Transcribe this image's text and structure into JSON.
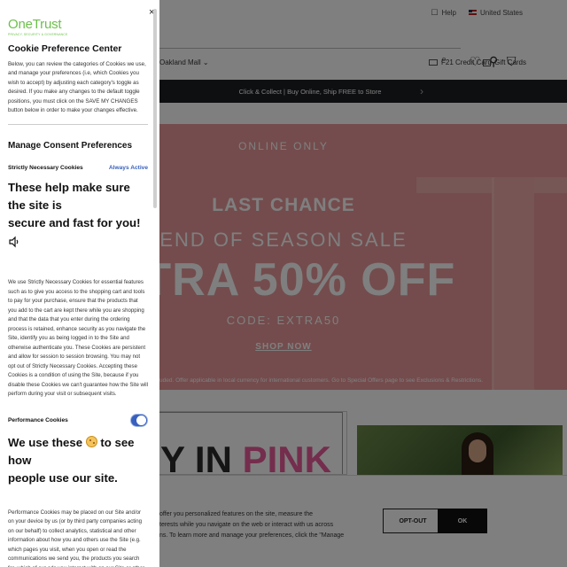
{
  "site": {
    "top": {
      "help": "Help",
      "country": "United States"
    },
    "store": {
      "name": "Oakland Mall",
      "credit_card": "F21 Credit Card",
      "gift_cards": "Gift Cards"
    },
    "promo": {
      "text": "Click & Collect | Buy Online, Ship FREE to Store"
    },
    "hero": {
      "online_only": "ONLINE ONLY",
      "last_chance": "LAST CHANCE",
      "end_of_season": "END OF SEASON SALE",
      "extra": "XTRA 50% OFF",
      "code": "CODE: EXTRA50",
      "shop_now": "SHOP NOW",
      "disclaimer": "uded. Offer applicable in local currency for international customers. Go to Special Offers page to see Exclusions & Restrictions."
    },
    "pink_section": {
      "word1": "Y IN ",
      "word2": "PINK"
    },
    "banner": {
      "text": "offer you personalized features on the site, measure the\nterests while you navigate on the web or interact with us across\nns. To learn more and manage your preferences, click the \"Manage",
      "opt_out": "OPT-OUT",
      "ok": "OK"
    }
  },
  "preference_center": {
    "logo": "OneTrust",
    "logo_tagline": "PRIVACY, SECURITY & GOVERNANCE",
    "close": "×",
    "title": "Cookie Preference Center",
    "description": "Below, you can review the categories of Cookies we use, and manage your preferences (i.e, which Cookies you wish to accept) by adjusting each category's toggle as desired. If you make any changes to the default toggle positions, you must click on the SAVE MY CHANGES button below in order to make your changes effective.",
    "manage_heading": "Manage Consent Preferences",
    "strict": {
      "name": "Strictly Necessary Cookies",
      "status": "Always Active",
      "headline_1": "These help make sure the site is",
      "headline_2": "secure and fast for you!",
      "description": "We use Strictly Necessary Cookies for essential features such as to give you access to the shopping cart and tools to pay for your purchase, ensure that the products that you add to the cart are kept there while you are shopping and that the data that you enter during the ordering process is retained, enhance security as you navigate the Site, identify you as being logged in to the Site and otherwise authenticate you. These Cookies are persistent and allow for session to session browsing. You may not opt out of Strictly Necessary Cookies. Accepting these Cookies is a condition of using the Site, because if you disable these Cookies we can't guarantee how the Site will perform during your visit or subsequent visits."
    },
    "performance": {
      "name": "Performance Cookies",
      "toggle_on": true,
      "headline_1a": "We use these",
      "headline_1b": "to see how",
      "headline_2": "people use our site.",
      "description": "Performance Cookies may be placed on our Site and/or on your device by us (or by third party companies acting on our behalf) to collect analytics, statistical and other information about how you and others use the Site (e.g. which pages you visit, when you open or read the communications we send you, the products you search for, which of our ads you interact with on our Site or other sites where our ads may appear, if you receive any error messages, how many users have viewed a product,"
    }
  },
  "colors": {
    "accent": "#3860be",
    "logo_green": "#6cc04a",
    "hero_pink": "#e8999a",
    "promo_bar": "#1d1f22"
  }
}
